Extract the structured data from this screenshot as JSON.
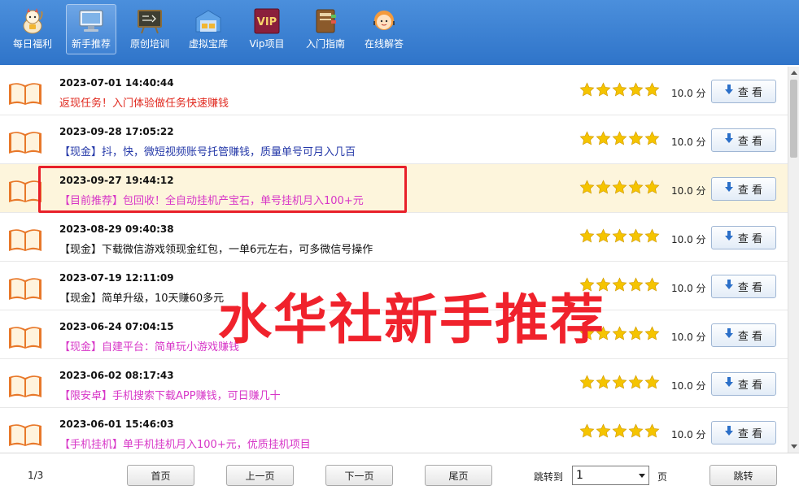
{
  "toolbar": {
    "items": [
      {
        "label": "每日福利",
        "icon": "lucky-cat-icon"
      },
      {
        "label": "新手推荐",
        "icon": "monitor-icon",
        "active": true
      },
      {
        "label": "原创培训",
        "icon": "blackboard-icon"
      },
      {
        "label": "虚拟宝库",
        "icon": "warehouse-icon"
      },
      {
        "label": "Vip项目",
        "icon": "vip-icon",
        "badge": "VIP"
      },
      {
        "label": "入门指南",
        "icon": "book-guide-icon"
      },
      {
        "label": "在线解答",
        "icon": "support-agent-icon"
      }
    ]
  },
  "list": {
    "rows": [
      {
        "date": "2023-07-01 14:40:44",
        "title": "返现任务！入门体验做任务快速赚钱",
        "color": "#e0281e",
        "stars": 5,
        "score": "10.0 分",
        "button": "查 看"
      },
      {
        "date": "2023-09-28 17:05:22",
        "title": "【现金】抖，快，微短视频账号托管赚钱，质量单号可月入几百",
        "color": "#2438a8",
        "stars": 5,
        "score": "10.0 分",
        "button": "查 看"
      },
      {
        "date": "2023-09-27 19:44:12",
        "title": "【目前推荐】包回收！全自动挂机产宝石，单号挂机月入100+元",
        "color": "#d735c7",
        "stars": 5,
        "score": "10.0 分",
        "button": "查 看",
        "highlight": true
      },
      {
        "date": "2023-08-29 09:40:38",
        "title": "【现金】下载微信游戏领现金红包，一单6元左右，可多微信号操作",
        "color": "#111111",
        "stars": 5,
        "score": "10.0 分",
        "button": "查 看"
      },
      {
        "date": "2023-07-19 12:11:09",
        "title": "【现金】简单升级，10天赚60多元",
        "color": "#111111",
        "stars": 5,
        "score": "10.0 分",
        "button": "查 看"
      },
      {
        "date": "2023-06-24 07:04:15",
        "title": "【现金】自建平台：简单玩小游戏赚钱",
        "color": "#d735c7",
        "stars": 5,
        "score": "10.0 分",
        "button": "查 看"
      },
      {
        "date": "2023-06-02 08:17:43",
        "title": "【限安卓】手机搜索下载APP赚钱，可日赚几十",
        "color": "#d735c7",
        "stars": 5,
        "score": "10.0 分",
        "button": "查 看"
      },
      {
        "date": "2023-06-01 15:46:03",
        "title": "【手机挂机】单手机挂机月入100+元，优质挂机项目",
        "color": "#d735c7",
        "stars": 5,
        "score": "10.0 分",
        "button": "查 看"
      }
    ]
  },
  "watermark": "水华社新手推荐",
  "footer": {
    "page_info": "1/3",
    "first": "首页",
    "prev": "上一页",
    "next": "下一页",
    "last": "尾页",
    "jump_label": "跳转到",
    "jump_value": "1",
    "page_unit": "页",
    "jump_button": "跳转"
  },
  "colors": {
    "toolbar": "#3a7fd0",
    "highlight_row": "#fdf5dc",
    "star": "#f5c400",
    "accent_red": "#e8202a"
  }
}
